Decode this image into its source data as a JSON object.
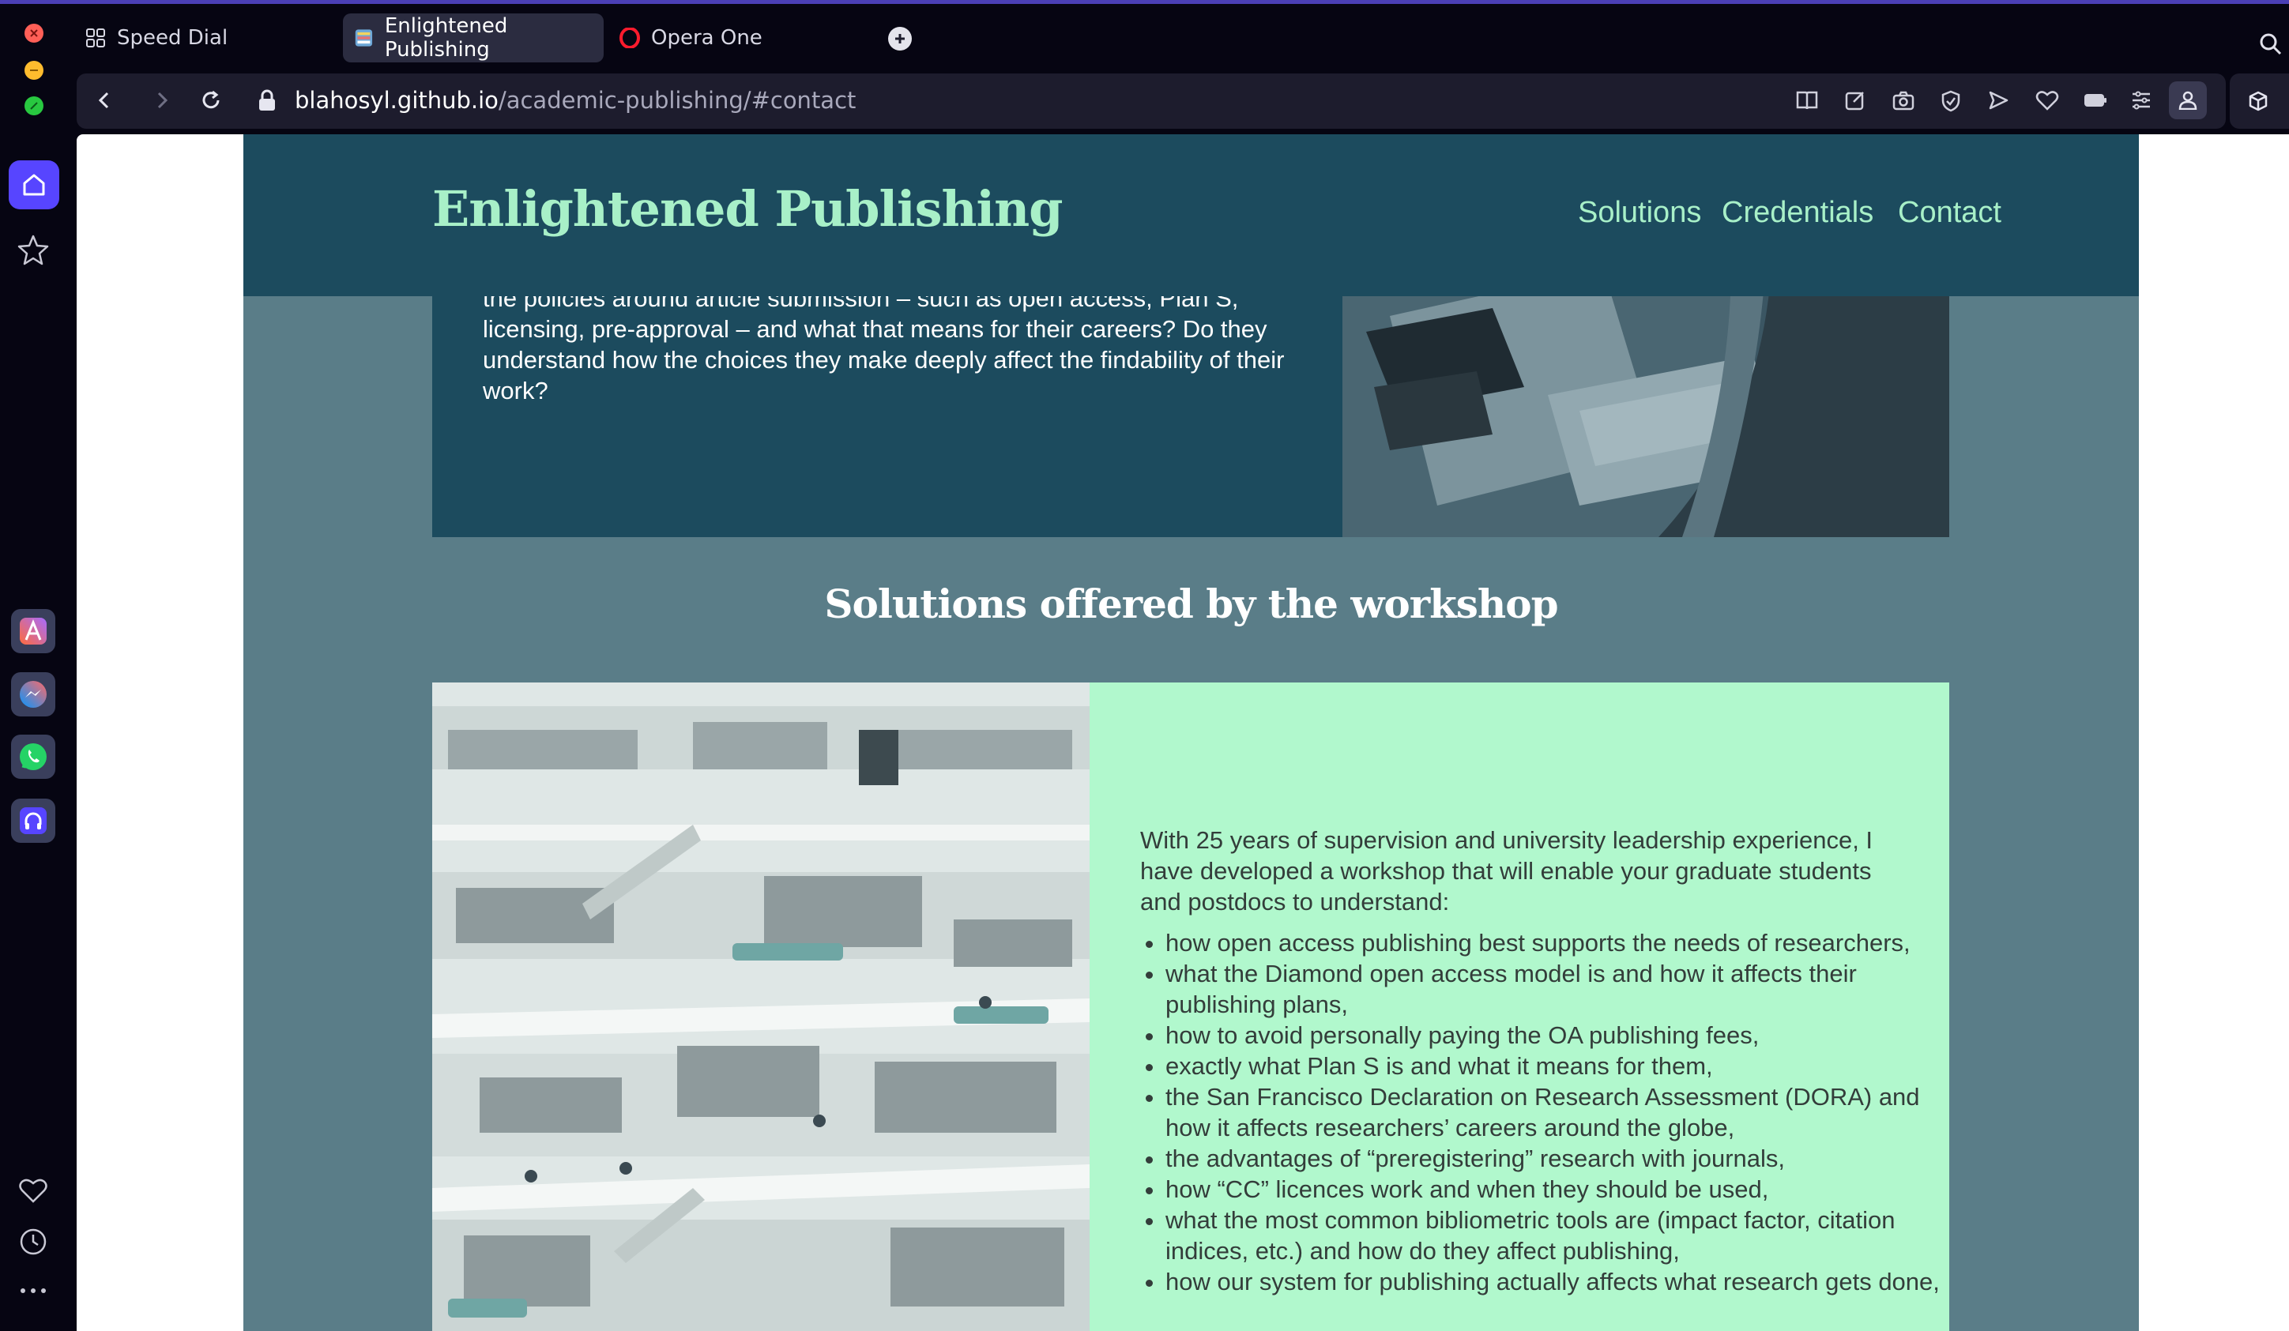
{
  "browser": {
    "tabs": [
      {
        "label": "Speed Dial",
        "icon": "grid-icon"
      },
      {
        "label": "Enlightened Publishing",
        "icon": "site-favicon"
      },
      {
        "label": "Opera One",
        "icon": "opera-logo-icon"
      }
    ],
    "url_host": "blahosyl.github.io",
    "url_path": "/academic-publishing/#contact",
    "accent_color": "#5745ff"
  },
  "sidebar": {
    "items": [
      "home-icon",
      "star-icon",
      "aria-icon",
      "messenger-icon",
      "whatsapp-icon",
      "music-player-icon",
      "heart-icon",
      "history-icon",
      "more-icon"
    ]
  },
  "site": {
    "brand": "Enlightened Publishing",
    "nav": [
      "Solutions",
      "Credentials",
      "Contact"
    ],
    "colors": {
      "header": "#1c4b5e",
      "accent": "#a8f0c8",
      "card": "#b1f8cd",
      "background": "#5a7d88"
    },
    "intro_lines": [
      "the policies around article submission – such as open access, Plan S,",
      "licensing, pre-approval – and what that means for their careers? Do they",
      "understand how the choices they make deeply affect the findability of their",
      "work?"
    ],
    "section_title": "Solutions offered by the workshop",
    "solutions_intro": "With 25 years of supervision and university leadership experience, I have developed a workshop that will enable your graduate students and postdocs to understand:",
    "solutions_list": [
      "how open access publishing best supports the needs of researchers,",
      "what the Diamond open access model is and how it affects their publishing plans,",
      "how to avoid personally paying the OA publishing fees,",
      "exactly what Plan S is and what it means for them,",
      "the San Francisco Declaration on Research Assessment (DORA) and how it affects researchers’ careers around the globe,",
      "the advantages of “preregistering” research with journals,",
      "how “CC” licences work and when they should be used,",
      "what the most common bibliometric tools are (impact factor, citation indices, etc.) and how do they affect publishing,",
      "how our system for publishing actually affects what research gets done,"
    ]
  }
}
